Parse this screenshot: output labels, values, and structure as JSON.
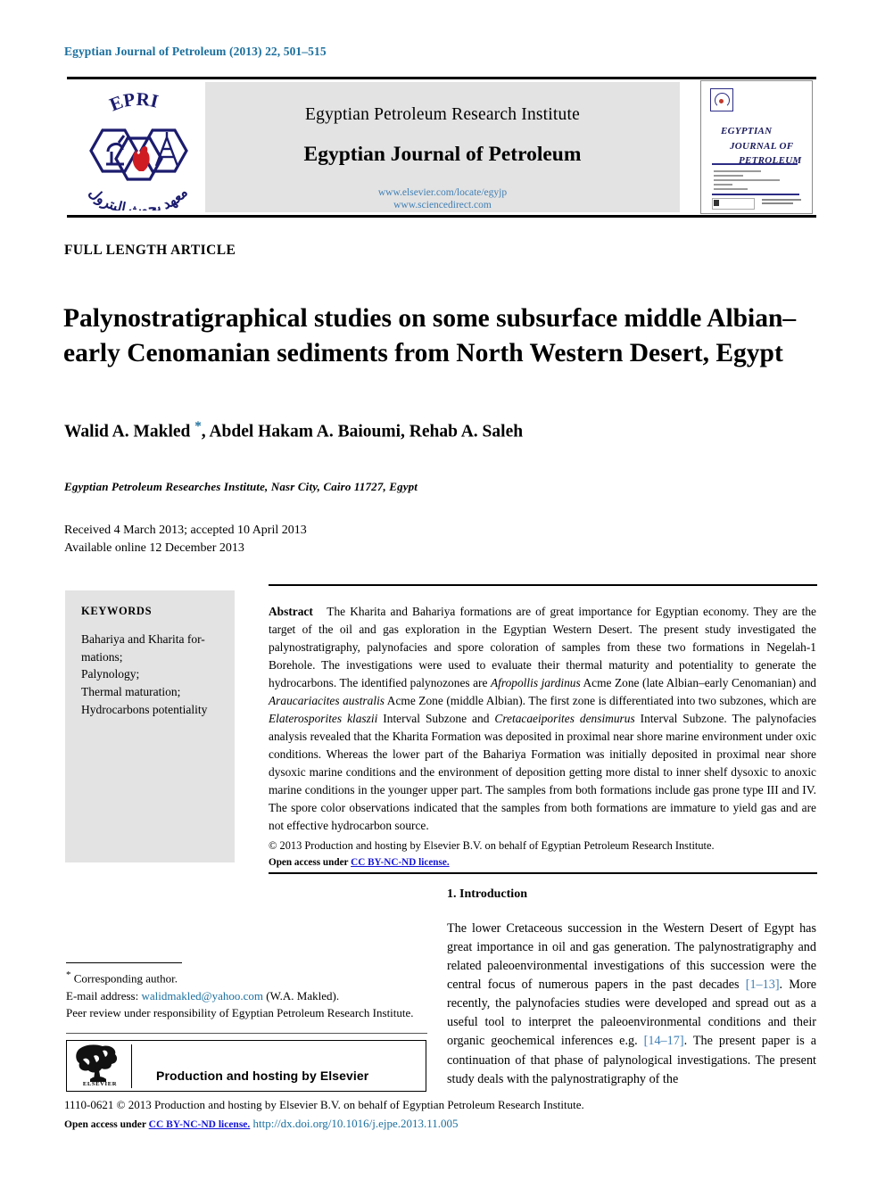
{
  "running_head": "Egyptian Journal of Petroleum (2013) 22, 501–515",
  "masthead": {
    "institute": "Egyptian Petroleum Research Institute",
    "journal": "Egyptian Journal of Petroleum",
    "link_elsevier": "www.elsevier.com/locate/egyjp",
    "link_sciencedirect": "www.sciencedirect.com",
    "logo_text": "EPRI",
    "cover": {
      "line1": "EGYPTIAN",
      "line2": "JOURNAL OF",
      "line3": "PETROLEUM"
    }
  },
  "article": {
    "type": "FULL LENGTH ARTICLE",
    "title": "Palynostratigraphical studies on some subsurface middle Albian–early Cenomanian sediments from North Western Desert, Egypt",
    "authors": "Walid A. Makled ",
    "authors_rest": ", Abdel Hakam A. Baioumi, Rehab A. Saleh",
    "author_star": "*",
    "affiliation": "Egyptian Petroleum Researches Institute, Nasr City, Cairo 11727, Egypt",
    "received": "Received 4 March 2013; accepted 10 April 2013",
    "available": "Available online 12 December 2013"
  },
  "keywords": {
    "heading": "KEYWORDS",
    "items": "Bahariya and Kharita for-mations;\nPalynology;\nThermal maturation;\nHydrocarbons potentiality",
    "list": [
      "Bahariya and Kharita for-",
      "mations;",
      "Palynology;",
      "Thermal maturation;",
      "Hydrocarbons potentiality"
    ]
  },
  "abstract": {
    "label": "Abstract",
    "p1": "The Kharita and Bahariya formations are of great importance for Egyptian economy. They are the target of the oil and gas exploration in the Egyptian Western Desert. The present study investigated the palynostratigraphy, palynofacies and spore coloration of samples from these two formations in Negelah-1 Borehole. The investigations were used to evaluate their thermal maturity and potentiality to generate the hydrocarbons. The identified palynozones are ",
    "it1": "Afropollis jardinus",
    "p2": " Acme Zone (late Albian–early Cenomanian) and ",
    "it2": "Araucariacites australis",
    "p3": " Acme Zone (middle Albian). The first zone is differentiated into two subzones, which are ",
    "it3": "Elaterosporites klaszii",
    "p4": " Interval Subzone and ",
    "it4": "Cretacaeiporites densimurus",
    "p5": " Interval Subzone. The palynofacies analysis revealed that the Kharita Formation was deposited in proximal near shore marine environment under oxic conditions. Whereas the lower part of the Bahariya Formation was initially deposited in proximal near shore dysoxic marine conditions and the environment of deposition getting more distal to inner shelf dysoxic to anoxic marine conditions in the younger upper part. The samples from both formations include gas prone type III and IV. The spore color observations indicated that the samples from both formations are immature to yield gas and are not effective hydrocarbon source.",
    "copyright": "© 2013 Production and hosting by Elsevier B.V. on behalf of Egyptian Petroleum Research Institute.",
    "open_access_prefix": "Open access under ",
    "license_link": "CC BY-NC-ND license."
  },
  "introduction": {
    "heading": "1. Introduction",
    "p1a": "The lower Cretaceous succession in the Western Desert of Egypt has great importance in oil and gas generation. The palynostratigraphy and related paleoenvironmental investigations of this succession were the central focus of numerous papers in the past decades ",
    "ref1": "[1–13]",
    "p1b": ". More recently, the palynofacies studies were developed and spread out as a useful tool to interpret the paleoenvironmental conditions and their organic geochemical inferences e.g. ",
    "ref2": "[14–17]",
    "p1c": ". The present paper is a continuation of that phase of palynological investigations. The present study deals with the palynostratigraphy of the"
  },
  "footnote": {
    "star": "*",
    "corresponding": " Corresponding author.",
    "email_label": "E-mail address: ",
    "email": "walidmakled@yahoo.com",
    "email_suffix": " (W.A. Makled).",
    "peer_review": "Peer review under responsibility of Egyptian Petroleum Research Institute."
  },
  "production_box": {
    "text": "Production and hosting by Elsevier",
    "logo_word": "ELSEVIER"
  },
  "legal": {
    "line1": "1110-0621 © 2013 Production and hosting by Elsevier B.V. on behalf of Egyptian Petroleum Research Institute.",
    "open_access_prefix": "Open access under ",
    "license_link": "CC BY-NC-ND license.",
    "doi": "http://dx.doi.org/10.1016/j.ejpe.2013.11.005"
  },
  "colors": {
    "running_head": "#1a6f9e",
    "link_blue": "#3f7fb5",
    "license_blue": "#1414d6",
    "gray_panel": "#e3e3e3",
    "logo_navy": "#2c2c85",
    "logo_red": "#c0392b"
  }
}
